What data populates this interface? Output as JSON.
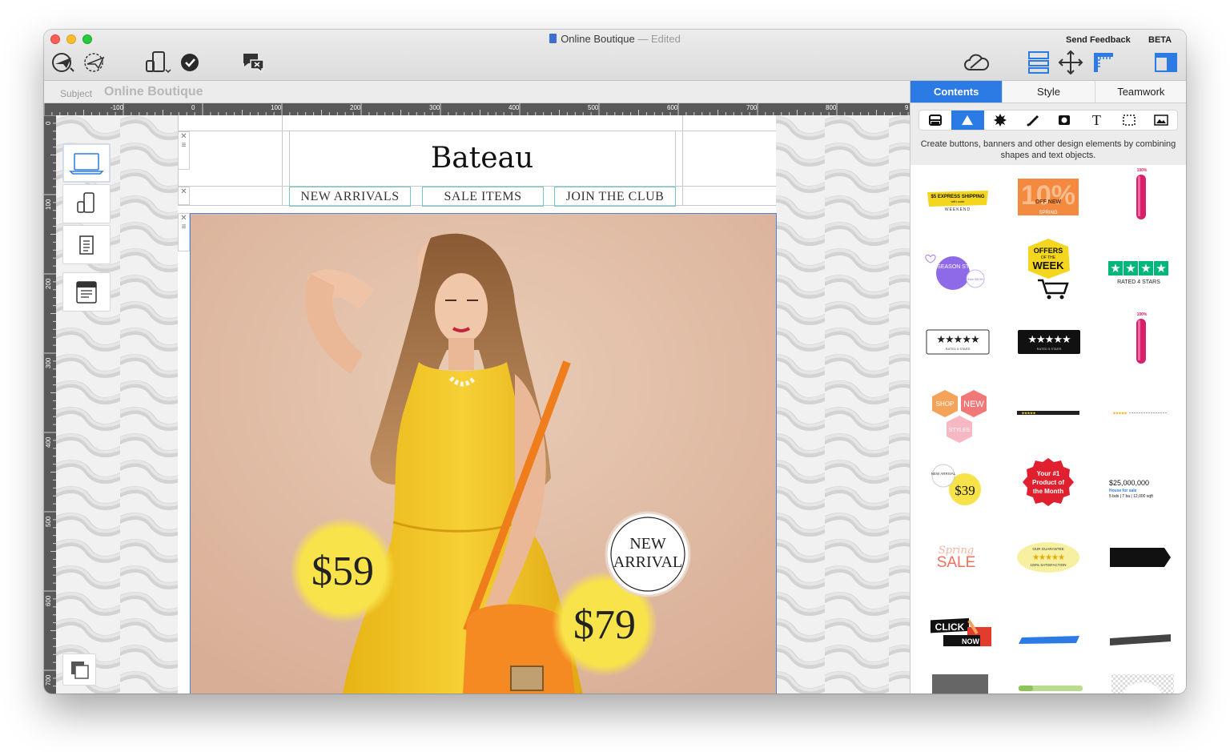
{
  "window": {
    "title": "Online Boutique",
    "edited": "— Edited",
    "send_feedback": "Send Feedback",
    "beta": "BETA"
  },
  "toolbar": {
    "left_icons": [
      "send-plane-icon",
      "test-send-icon",
      "device-preview-icon",
      "check-icon",
      "chat-icon"
    ],
    "right_icons": [
      "cloud-icon",
      "layout-icon",
      "move-icon",
      "ruler-icon",
      "sidebar-icon"
    ]
  },
  "subject": {
    "label": "Subject",
    "value": "Online Boutique"
  },
  "ruler": {
    "h_labels": [
      "-100",
      "0",
      "100",
      "200",
      "300",
      "400",
      "500",
      "600",
      "700",
      "800",
      "9"
    ],
    "v_labels": [
      "0",
      "100",
      "200",
      "300",
      "400",
      "500",
      "600",
      "700"
    ]
  },
  "email": {
    "logo": "Bateau",
    "nav": [
      "NEW ARRIVALS",
      "SALE ITEMS",
      "JOIN THE CLUB"
    ],
    "badge_price_1": "$59",
    "badge_price_2": "$79",
    "badge_new": "NEW",
    "badge_arrival": "ARRIVAL"
  },
  "panel": {
    "tabs": [
      "Contents",
      "Style",
      "Teamwork"
    ],
    "active_tab": "Contents",
    "description": "Create buttons, banners and other design elements by combining shapes and text objects.",
    "gallery": {
      "express_shipping": "$5 EXPRESS SHIPPING",
      "express_sub": "with code",
      "weekend": "WEEKEND",
      "ten_percent": "10%",
      "off_new": "OFF NEW",
      "spring": "SPRING",
      "pct_100": "100%",
      "new_season": "NEW SEASON STYLES",
      "from_price": "from $9.99",
      "offers": "OFFERS",
      "of_the": "OF THE",
      "week": "WEEK",
      "rated_4": "RATED 4 STARS",
      "rated_5": "RATED 5 STARS",
      "shop": "SHOP",
      "new": "NEW",
      "styles": "STYLES",
      "new_arrival_small": "NEW ARRIVAL",
      "price_39": "$39",
      "your_1": "Your #1",
      "product_of": "Product of",
      "the_month": "the Month",
      "house_price": "$25,000,000",
      "house_for_sale": "House for sale",
      "house_details": "5 bds | 7 ba | 12,000 sqft",
      "spring_word": "Spring",
      "sale": "SALE",
      "our_guarantee": "OUR GUARANTEE",
      "satisfaction": "100% SATISFACTION",
      "click": "CLICK",
      "now": "NOW"
    }
  },
  "colors": {
    "accent": "#2c7be5",
    "ruler": "#595959",
    "badge_yellow": "#f7e24a",
    "dress_yellow": "#f2c21c",
    "nav_border": "#6fc9c9"
  }
}
